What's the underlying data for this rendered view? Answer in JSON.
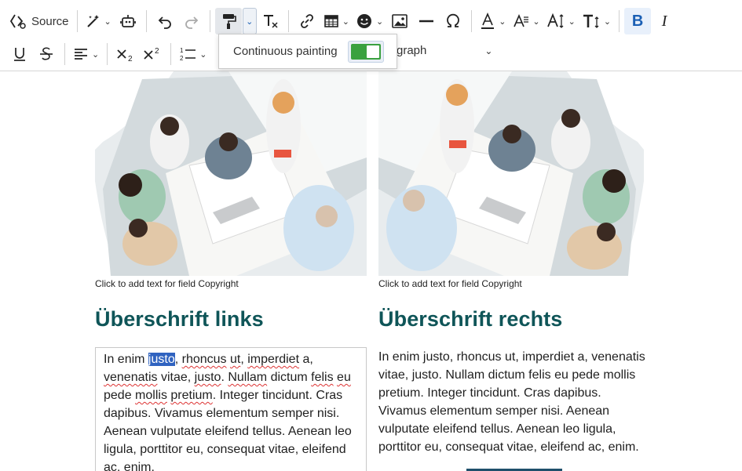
{
  "toolbar": {
    "source_label": "Source",
    "row1_icons": [
      "magic-wand-icon",
      "robot-icon",
      "undo-icon",
      "redo-icon",
      "paint-roller-icon",
      "remove-format-icon",
      "link-icon",
      "table-icon",
      "emoji-icon",
      "image-icon",
      "horizontal-line-icon",
      "omega-icon",
      "font-color-icon",
      "font-background-icon",
      "font-size-icon",
      "text-height-icon",
      "bold-icon",
      "italic-icon"
    ],
    "row2_icons": [
      "underline-icon",
      "strikethrough-icon",
      "align-left-icon",
      "subscript-icon",
      "superscript-icon",
      "numbered-list-icon"
    ],
    "paragraph_partial": "graph",
    "accent": "#1a5fb4"
  },
  "popup": {
    "label": "Continuous painting",
    "toggle_on": true,
    "toggle_color": "#3aa13f"
  },
  "left": {
    "caption": "Click to add text for field Copyright",
    "heading": "Überschrift links",
    "para_before": "In enim ",
    "para_selected": "justo",
    "para_after_1": ", ",
    "w_rhoncus": "rhoncus",
    "p_a": " ",
    "w_ut": "ut",
    "p_b": ", ",
    "w_imperdiet": "imperdiet",
    "p_c": " a, ",
    "w_venenatis": "venenatis",
    "p_d": " vitae, ",
    "w_justo2": "justo",
    "p_e": ". ",
    "w_nullam": "Nullam",
    "p_f": " dictum ",
    "w_felis": "felis",
    "p_g": " ",
    "w_eu": "eu",
    "p_h": " pede ",
    "w_mollis": "mollis",
    "p_i": " ",
    "w_pretium": "pretium",
    "p_rest": ". Integer tincidunt. Cras dapibus. Vivamus elementum semper nisi. Aenean vulputate eleifend tellus. Aenean leo ligula, porttitor eu, consequat vitae, eleifend ac, enim."
  },
  "right": {
    "caption": "Click to add text for field Copyright",
    "heading": "Überschrift rechts",
    "paragraph": "In enim justo, rhoncus ut, imperdiet a, venenatis vitae, justo. Nullam dictum felis eu pede mollis pretium. Integer tincidunt. Cras dapibus. Vivamus elementum semper nisi. Aenean vulputate eleifend tellus. Aenean leo ligula, porttitor eu, consequat vitae, eleifend ac, enim."
  },
  "colors": {
    "heading": "#0f5558",
    "selection": "#3063c0",
    "spellcheck": "#d33"
  }
}
